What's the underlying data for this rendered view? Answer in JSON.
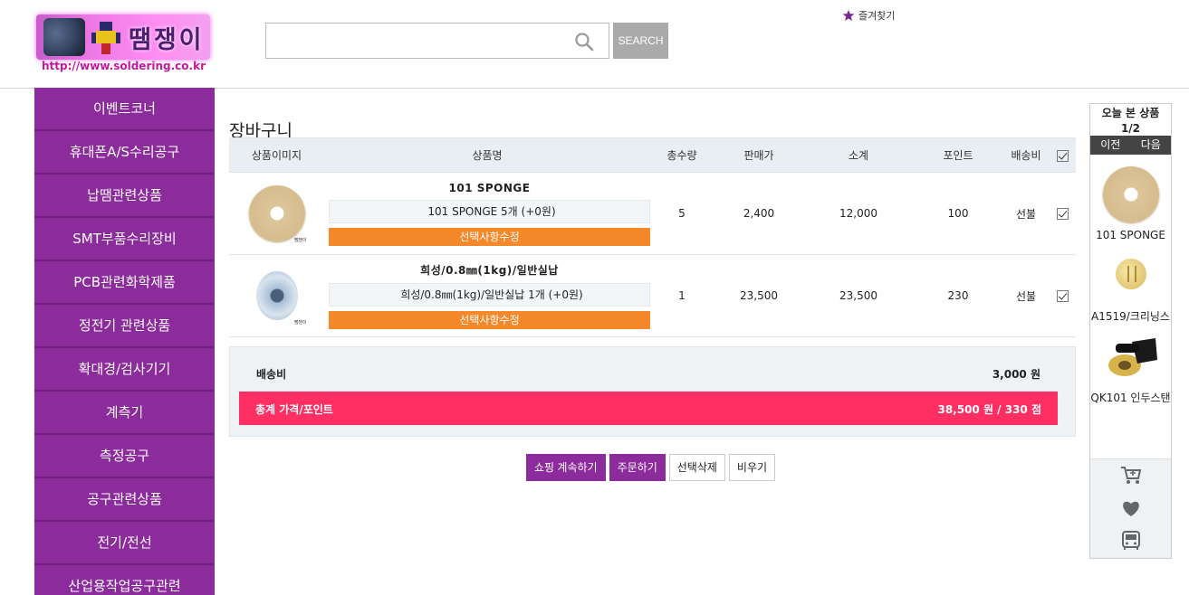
{
  "header": {
    "logo_text": "땜쟁이",
    "logo_url": "http://www.soldering.co.kr",
    "search_placeholder": "",
    "search_button": "SEARCH",
    "favorites": "즐겨찾기"
  },
  "sidebar": {
    "items": [
      {
        "label": "이벤트코너"
      },
      {
        "label": "휴대폰A/S수리공구"
      },
      {
        "label": "납땜관련상품"
      },
      {
        "label": "SMT부품수리장비"
      },
      {
        "label": "PCB관련화학제품"
      },
      {
        "label": "정전기 관련상품"
      },
      {
        "label": "확대경/검사기기"
      },
      {
        "label": "계측기"
      },
      {
        "label": "측정공구"
      },
      {
        "label": "공구관련상품"
      },
      {
        "label": "전기/전선"
      },
      {
        "label": "산업용작업공구관련"
      }
    ]
  },
  "cart": {
    "title": "장바구니",
    "columns": [
      "상품이미지",
      "상품명",
      "총수량",
      "판매가",
      "소계",
      "포인트",
      "배송비"
    ],
    "rows": [
      {
        "name": "101 SPONGE",
        "option": "101 SPONGE 5개 (+0원)",
        "option_button": "선택사항수정",
        "qty": "5",
        "price": "2,400",
        "subtotal": "12,000",
        "points": "100",
        "shipping": "선불",
        "image_mark": "땜쟁이"
      },
      {
        "name": "희성/0.8㎜(1kg)/일반실납",
        "option": "희성/0.8㎜(1kg)/일반실납 1개 (+0원)",
        "option_button": "선택사항수정",
        "qty": "1",
        "price": "23,500",
        "subtotal": "23,500",
        "points": "230",
        "shipping": "선불",
        "image_mark": "땜쟁이"
      }
    ],
    "shipping_label": "배송비",
    "shipping_value": "3,000 원",
    "total_label": "총계 가격/포인트",
    "total_value": "38,500 원 / 330 점"
  },
  "actions": {
    "continue": "쇼핑 계속하기",
    "order": "주문하기",
    "delete_selected": "선택삭제",
    "empty": "비우기"
  },
  "recent": {
    "title": "오늘 본 상품",
    "page": "1/2",
    "prev": "이전",
    "next": "다음",
    "items": [
      {
        "name": "101 SPONGE"
      },
      {
        "name": "A1519/크리닝스"
      },
      {
        "name": "QK101 인두스탠"
      }
    ],
    "icons": [
      "cart-icon",
      "heart-icon",
      "bus-icon"
    ]
  },
  "colors": {
    "brand_purple": "#8c2b9c",
    "option_orange": "#f5882a",
    "total_pink": "#ff2e63"
  }
}
